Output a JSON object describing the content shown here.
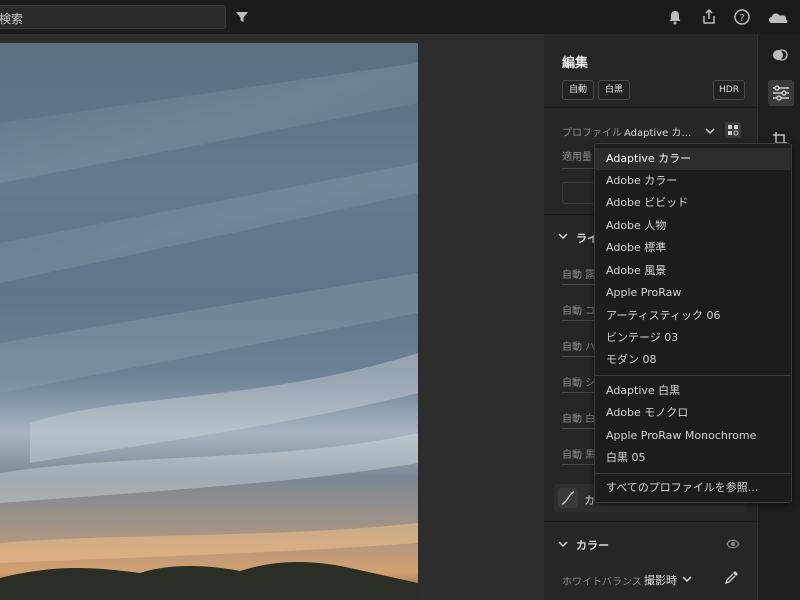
{
  "topbar": {
    "search_text": "検索"
  },
  "edit_panel": {
    "title": "編集",
    "chips": {
      "auto": "自動",
      "bw": "白黒",
      "hdr": "HDR"
    },
    "profile_label": "プロファイル",
    "profile_value": "Adaptive カ…",
    "amount_label": "適用量",
    "light_section_title": "ライ",
    "light_sliders": [
      "自動 露",
      "自動 コ",
      "自動 ハ",
      "自動 シ",
      "自動 白",
      "自動 黒"
    ],
    "curve_label": "カ",
    "color_section_title": "カラー",
    "white_balance_label": "ホワイトバランス",
    "white_balance_value": "撮影時"
  },
  "profile_menu": {
    "items_group1": [
      "Adaptive カラー",
      "Adobe カラー",
      "Adobe ビビッド",
      "Adobe 人物",
      "Adobe 標準",
      "Adobe 風景",
      "Apple ProRaw",
      "アーティスティック 06",
      "ビンテージ 03",
      "モダン 08"
    ],
    "items_group2": [
      "Adaptive 白黒",
      "Adobe モノクロ",
      "Apple ProRaw Monochrome",
      "白黒 05"
    ],
    "browse_all": "すべてのプロファイルを参照..."
  },
  "icons": {
    "filter": "filter-icon",
    "bell": "bell-icon",
    "share": "share-icon",
    "help": "help-icon",
    "cloud": "cloud-icon",
    "masking": "masking-icon",
    "edit_sliders": "sliders-icon",
    "crop": "crop-icon",
    "eye": "eye-icon",
    "eyedropper": "eyedropper-icon",
    "chevron": "chevron-down-icon",
    "profile_browser": "profile-browser-icon"
  },
  "colors": {
    "panel": "#262626",
    "menu": "#1c1c1c",
    "accent_text": "#e8e8e8"
  }
}
